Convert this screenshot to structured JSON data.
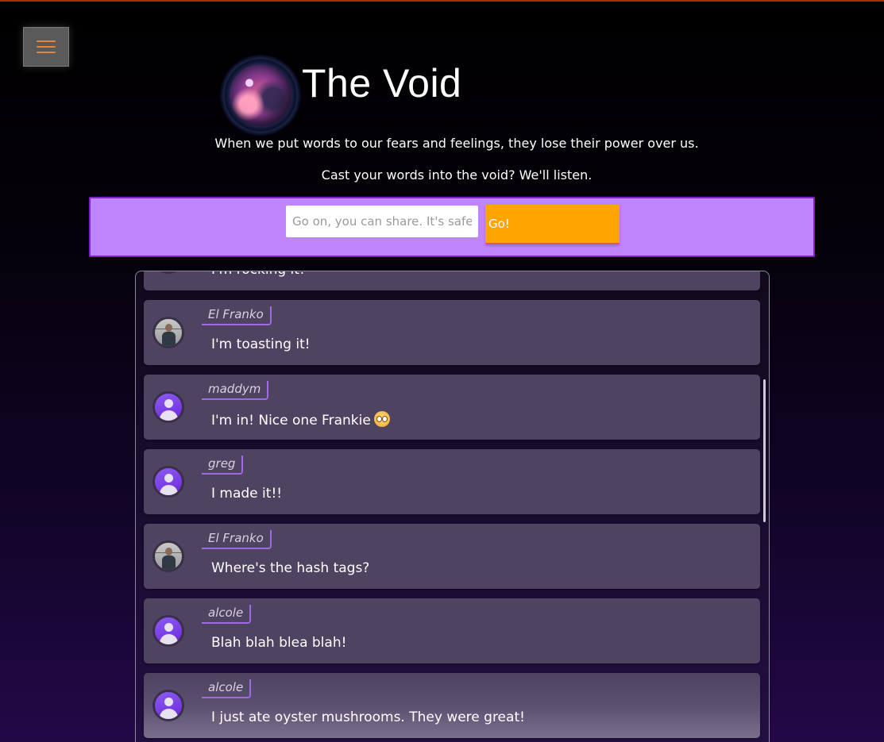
{
  "header": {
    "title": "The Void",
    "tagline_1": "When we put words to our fears and feelings, they lose their power over us.",
    "tagline_2": "Cast your words into the void? We'll listen."
  },
  "share": {
    "placeholder": "Go on, you can share. It's safe",
    "button_label": "Go!"
  },
  "posts": [
    {
      "author": "",
      "message": "I'm rocking it!",
      "avatar": "photo-avatar"
    },
    {
      "author": "El Franko",
      "message": "I'm toasting it!",
      "avatar": "photo-avatar"
    },
    {
      "author": "maddym",
      "message": "I'm in! Nice one Frankie",
      "avatar": "default-avatar",
      "emoji": "flushed-face-emoji"
    },
    {
      "author": "greg",
      "message": "I made it!!",
      "avatar": "default-avatar"
    },
    {
      "author": "El Franko",
      "message": "Where's the hash tags?",
      "avatar": "photo-avatar"
    },
    {
      "author": "alcole",
      "message": "Blah blah blea blah!",
      "avatar": "default-avatar"
    },
    {
      "author": "alcole",
      "message": "I just ate oyster mushrooms. They were great!",
      "avatar": "default-avatar"
    }
  ],
  "colors": {
    "accent_orange": "#ffa500",
    "panel_purple": "#c084fc",
    "card_bg": "#4e4360",
    "author_border": "#a06ae0"
  }
}
